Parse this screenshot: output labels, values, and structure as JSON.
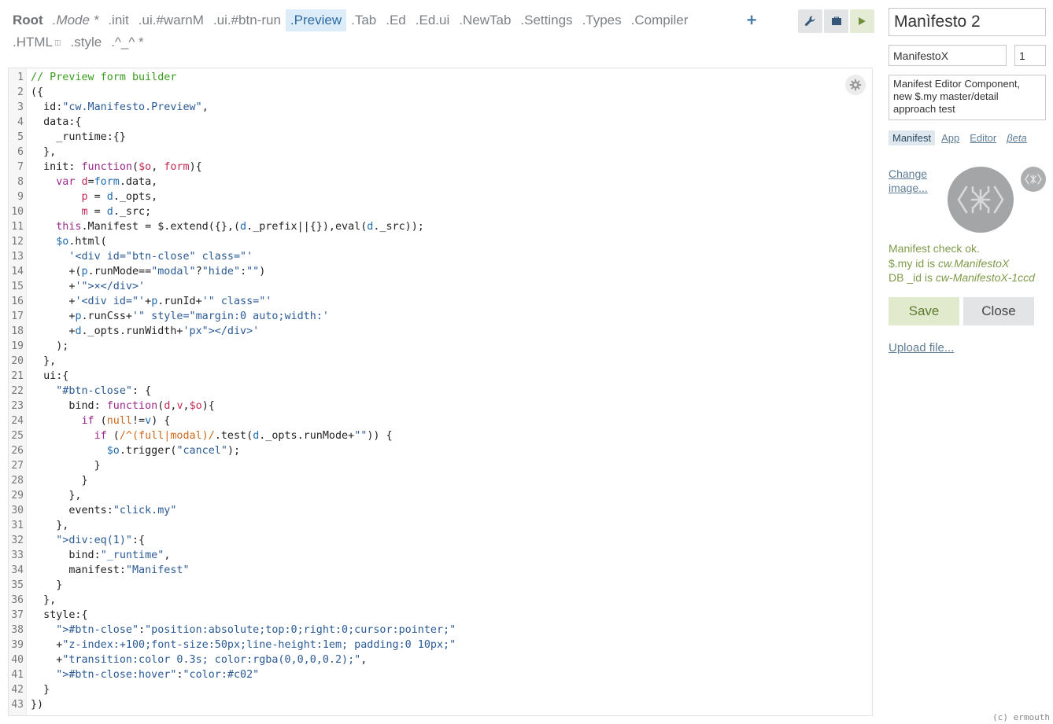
{
  "tabs": [
    {
      "label": "Root",
      "name": "tab-root",
      "style": "root"
    },
    {
      "label": ".Mode *",
      "name": "tab-mode",
      "style": "italic"
    },
    {
      "label": ".init",
      "name": "tab-init",
      "style": ""
    },
    {
      "label": ".ui.#warnM",
      "name": "tab-ui-warnm",
      "style": ""
    },
    {
      "label": ".ui.#btn-run",
      "name": "tab-ui-btn-run",
      "style": ""
    },
    {
      "label": ".Preview",
      "name": "tab-preview",
      "style": "active"
    },
    {
      "label": ".Tab",
      "name": "tab-tab",
      "style": ""
    },
    {
      "label": ".Ed",
      "name": "tab-ed",
      "style": ""
    },
    {
      "label": ".Ed.ui",
      "name": "tab-ed-ui",
      "style": ""
    },
    {
      "label": ".NewTab",
      "name": "tab-newtab",
      "style": ""
    },
    {
      "label": ".Settings",
      "name": "tab-settings",
      "style": ""
    },
    {
      "label": ".Types",
      "name": "tab-types",
      "style": ""
    },
    {
      "label": ".Compiler",
      "name": "tab-compiler",
      "style": ""
    },
    {
      "label": ".HTML",
      "name": "tab-html",
      "style": "",
      "sup": " "
    },
    {
      "label": ".style",
      "name": "tab-style",
      "style": ""
    },
    {
      "label": ".^_^ *",
      "name": "tab-smiley",
      "style": ""
    }
  ],
  "toolbar": {
    "add_icon": "plus-icon",
    "buttons": [
      {
        "name": "settings-tool-button",
        "icon": "wrench-icon"
      },
      {
        "name": "bundle-tool-button",
        "icon": "briefcase-icon"
      },
      {
        "name": "run-button",
        "icon": "play-icon"
      }
    ]
  },
  "editor": {
    "gear_icon": "gear-icon",
    "lines": [
      [
        [
          "c-com",
          "// Preview form builder"
        ]
      ],
      [
        [
          "",
          "({"
        ]
      ],
      [
        [
          "",
          "  id:"
        ],
        [
          "c-str",
          "\"cw.Manifesto.Preview\""
        ],
        [
          "",
          ","
        ]
      ],
      [
        [
          "",
          "  data:{"
        ]
      ],
      [
        [
          "",
          "    _runtime:{}"
        ]
      ],
      [
        [
          "",
          "  },"
        ]
      ],
      [
        [
          "",
          "  init: "
        ],
        [
          "c-kw",
          "function"
        ],
        [
          "",
          "("
        ],
        [
          "c-var",
          "$o"
        ],
        [
          "",
          ", "
        ],
        [
          "c-var",
          "form"
        ],
        [
          "",
          "){"
        ]
      ],
      [
        [
          "",
          "    "
        ],
        [
          "c-kw",
          "var"
        ],
        [
          "",
          ""
        ],
        [
          "c-var",
          " d"
        ],
        [
          "",
          "="
        ],
        [
          "c-def",
          "form"
        ],
        [
          "",
          ".data,"
        ]
      ],
      [
        [
          "",
          "        "
        ],
        [
          "c-var",
          "p"
        ],
        [
          "",
          " = "
        ],
        [
          "c-def",
          "d"
        ],
        [
          "",
          "._opts,"
        ]
      ],
      [
        [
          "",
          "        "
        ],
        [
          "c-var",
          "m"
        ],
        [
          "",
          " = "
        ],
        [
          "c-def",
          "d"
        ],
        [
          "",
          "._src;"
        ]
      ],
      [
        [
          "",
          "    "
        ],
        [
          "c-kw",
          "this"
        ],
        [
          "",
          ".Manifest = $.extend({},("
        ],
        [
          "c-def",
          "d"
        ],
        [
          "",
          "._prefix||{}),eval("
        ],
        [
          "c-def",
          "d"
        ],
        [
          "",
          "._src));"
        ]
      ],
      [
        [
          "",
          "    "
        ],
        [
          "c-def",
          "$o"
        ],
        [
          "",
          ".html("
        ]
      ],
      [
        [
          "",
          "      "
        ],
        [
          "c-str",
          "'<div id=\"btn-close\" class=\"'"
        ]
      ],
      [
        [
          "",
          "      +("
        ],
        [
          "c-def",
          "p"
        ],
        [
          "",
          ".runMode=="
        ],
        [
          "c-str",
          "\"modal\""
        ],
        [
          "",
          "?"
        ],
        [
          "c-str",
          "\"hide\""
        ],
        [
          "",
          ":"
        ],
        [
          "c-str",
          "\"\""
        ],
        [
          "",
          ")"
        ]
      ],
      [
        [
          "",
          "      +"
        ],
        [
          "c-str",
          "'\">×</div>'"
        ]
      ],
      [
        [
          "",
          "      +"
        ],
        [
          "c-str",
          "'<div id=\"'"
        ],
        [
          "",
          "+"
        ],
        [
          "c-def",
          "p"
        ],
        [
          "",
          ".runId+"
        ],
        [
          "c-str",
          "'\" class=\"'"
        ]
      ],
      [
        [
          "",
          "      +"
        ],
        [
          "c-def",
          "p"
        ],
        [
          "",
          ".runCss+"
        ],
        [
          "c-str",
          "'\" style=\"margin:0 auto;width:'"
        ]
      ],
      [
        [
          "",
          "      +"
        ],
        [
          "c-def",
          "d"
        ],
        [
          "",
          "._opts.runWidth+"
        ],
        [
          "c-str",
          "'px\"></div>'"
        ]
      ],
      [
        [
          "",
          "    );"
        ]
      ],
      [
        [
          "",
          "  },"
        ]
      ],
      [
        [
          "",
          "  ui:{"
        ]
      ],
      [
        [
          "",
          "    "
        ],
        [
          "c-str",
          "\"#btn-close\""
        ],
        [
          "",
          ": {"
        ]
      ],
      [
        [
          "",
          "      bind: "
        ],
        [
          "c-kw",
          "function"
        ],
        [
          "",
          "("
        ],
        [
          "c-var",
          "d"
        ],
        [
          "",
          ","
        ],
        [
          "c-var",
          "v"
        ],
        [
          "",
          ","
        ],
        [
          "c-var",
          "$o"
        ],
        [
          "",
          "){"
        ]
      ],
      [
        [
          "",
          "        "
        ],
        [
          "c-kw",
          "if"
        ],
        [
          "",
          " ("
        ],
        [
          "c-atom",
          "null"
        ],
        [
          "",
          "!="
        ],
        [
          "c-def",
          "v"
        ],
        [
          "",
          ") {"
        ]
      ],
      [
        [
          "",
          "          "
        ],
        [
          "c-kw",
          "if"
        ],
        [
          "",
          " ("
        ],
        [
          "c-re",
          "/^(full|modal)/"
        ],
        [
          "",
          ".test("
        ],
        [
          "c-def",
          "d"
        ],
        [
          "",
          "._opts.runMode+"
        ],
        [
          "c-str",
          "\"\""
        ],
        [
          "",
          ")) {"
        ]
      ],
      [
        [
          "",
          "            "
        ],
        [
          "c-def",
          "$o"
        ],
        [
          "",
          ".trigger("
        ],
        [
          "c-str",
          "\"cancel\""
        ],
        [
          "",
          ");"
        ]
      ],
      [
        [
          "",
          "          }"
        ]
      ],
      [
        [
          "",
          "        }"
        ]
      ],
      [
        [
          "",
          "      },"
        ]
      ],
      [
        [
          "",
          "      events:"
        ],
        [
          "c-str",
          "\"click.my\""
        ]
      ],
      [
        [
          "",
          "    },"
        ]
      ],
      [
        [
          "",
          "    "
        ],
        [
          "c-str",
          "\">div:eq(1)\""
        ],
        [
          "",
          ":{"
        ]
      ],
      [
        [
          "",
          "      bind:"
        ],
        [
          "c-str",
          "\"_runtime\""
        ],
        [
          "",
          ","
        ]
      ],
      [
        [
          "",
          "      manifest:"
        ],
        [
          "c-str",
          "\"Manifest\""
        ]
      ],
      [
        [
          "",
          "    }"
        ]
      ],
      [
        [
          "",
          "  },"
        ]
      ],
      [
        [
          "",
          "  style:{"
        ]
      ],
      [
        [
          "",
          "    "
        ],
        [
          "c-str",
          "\">#btn-close\""
        ],
        [
          "",
          ":"
        ],
        [
          "c-str",
          "\"position:absolute;top:0;right:0;cursor:pointer;\""
        ]
      ],
      [
        [
          "",
          "    +"
        ],
        [
          "c-str",
          "\"z-index:+100;font-size:50px;line-height:1em; padding:0 10px;\""
        ]
      ],
      [
        [
          "",
          "    +"
        ],
        [
          "c-str",
          "\"transition:color 0.3s; color:rgba(0,0,0,0.2);\""
        ],
        [
          "",
          ","
        ]
      ],
      [
        [
          "",
          "    "
        ],
        [
          "c-str",
          "\">#btn-close:hover\""
        ],
        [
          "",
          ":"
        ],
        [
          "c-str",
          "\"color:#c02\""
        ]
      ],
      [
        [
          "",
          "  }"
        ]
      ],
      [
        [
          "",
          "})"
        ]
      ]
    ]
  },
  "panel": {
    "name_value": "Manìfesto 2",
    "id_value": "ManifestoX",
    "version_value": "1",
    "description_value": "Manifest Editor Component, new $.my master/detail approach test",
    "subtabs": [
      {
        "label": "Manifest",
        "name": "subtab-manifest",
        "style": "active"
      },
      {
        "label": "App",
        "name": "subtab-app",
        "style": ""
      },
      {
        "label": "Editor",
        "name": "subtab-editor",
        "style": ""
      },
      {
        "label": "βeta",
        "name": "subtab-beta",
        "style": "italic"
      }
    ],
    "change_image_label": "Change image...",
    "logo_icon": "manifesto-logo-icon",
    "status": {
      "line1": "Manifest check ok.",
      "line2_prefix": "$.my id is ",
      "line2_value": "cw.ManifestoX",
      "line3_prefix": "DB _id is ",
      "line3_value": "cw-ManifestoX-1ccd"
    },
    "save_label": "Save",
    "close_label": "Close",
    "upload_label": "Upload file..."
  },
  "footer": {
    "copyright": "(c) ermouth"
  },
  "colors": {
    "accent": "#2b6aa2",
    "active_tab_bg": "#dcecf8",
    "save_bg": "#e1eacd",
    "status_ok": "#7f9a4a"
  }
}
